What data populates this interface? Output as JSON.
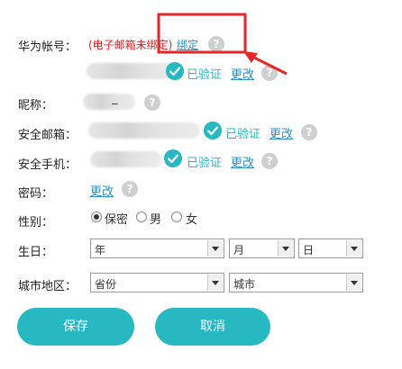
{
  "labels": {
    "huawei_account": "华为帐号：",
    "nickname": "昵称：",
    "email": "安全邮箱：",
    "phone": "安全手机：",
    "password": "密码：",
    "gender": "性别：",
    "birthday": "生日：",
    "region": "城市地区："
  },
  "account": {
    "unbound_text": "(电子邮箱未绑定)",
    "bind_link": "绑定",
    "verified": "已验证",
    "change_link": "更改"
  },
  "nickname": {
    "value": "_"
  },
  "email": {
    "verified": "已验证",
    "change_link": "更改"
  },
  "phone": {
    "verified": "已验证",
    "change_link": "更改"
  },
  "password": {
    "change_link": "更改"
  },
  "gender": {
    "options": [
      "保密",
      "男",
      "女"
    ],
    "selected": "保密"
  },
  "birthday": {
    "year": "年",
    "month": "月",
    "day": "日"
  },
  "region": {
    "province": "省份",
    "city": "城市"
  },
  "buttons": {
    "save": "保存",
    "cancel": "取消"
  },
  "help_glyph": "?",
  "colors": {
    "accent": "#27b8c2",
    "link": "#2a8fc4",
    "warning": "#e02020",
    "annotation": "#e5262a"
  },
  "icons": [
    "check-icon",
    "help-icon",
    "dropdown-arrow-icon"
  ]
}
